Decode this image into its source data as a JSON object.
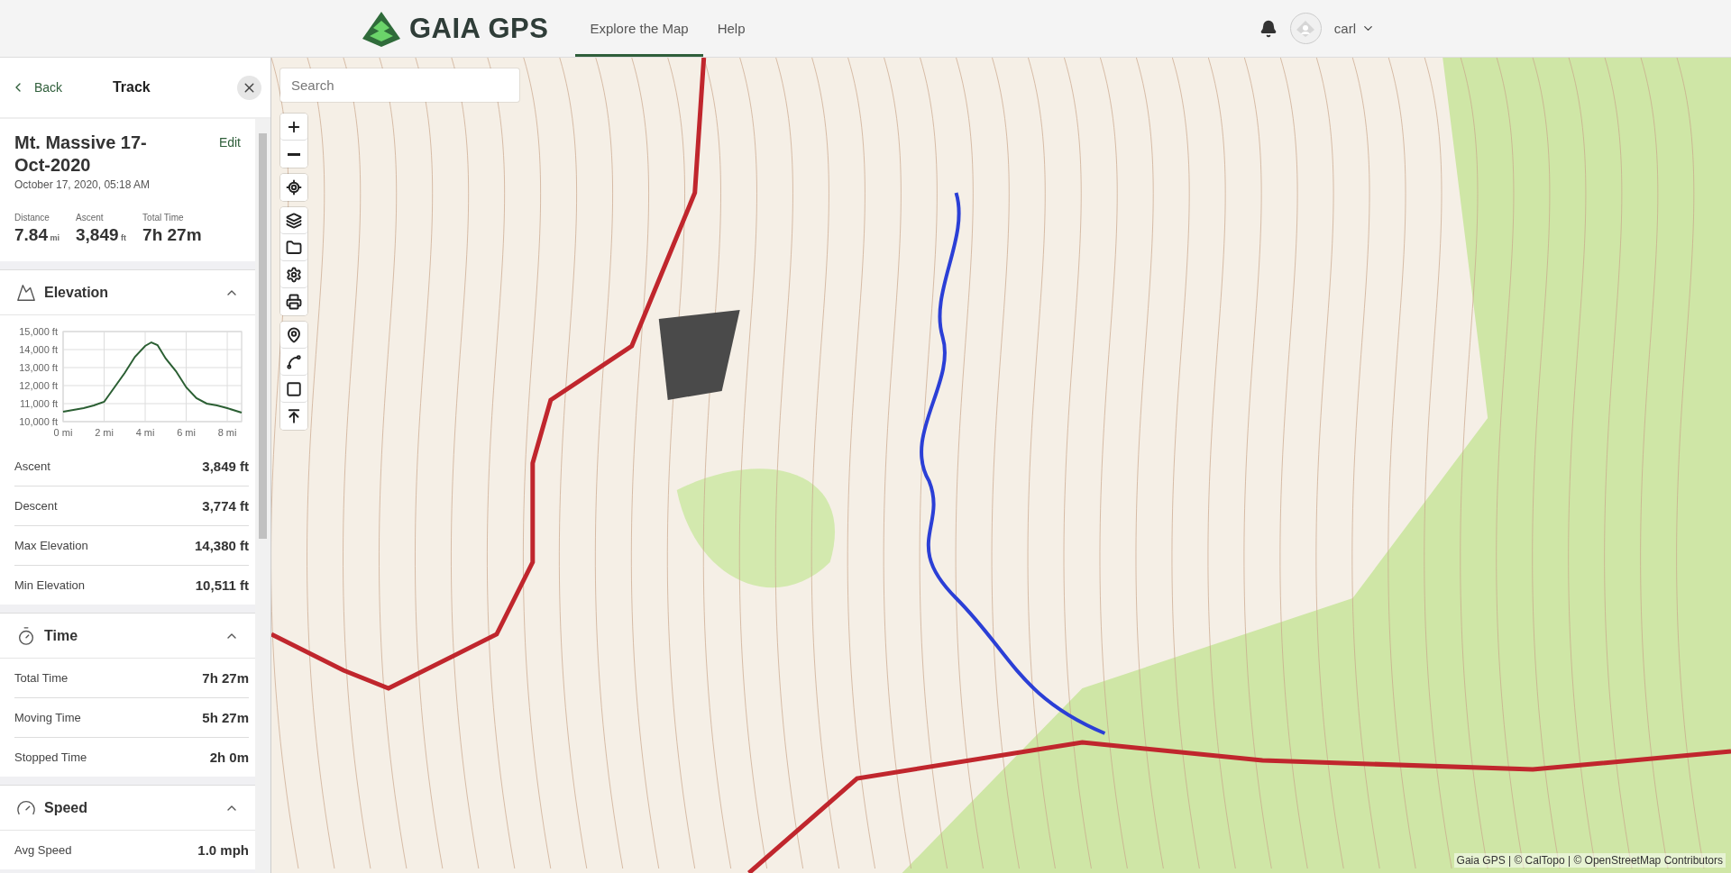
{
  "header": {
    "logo_text": "GAIA GPS",
    "nav": [
      {
        "label": "Explore the Map",
        "selected": true
      },
      {
        "label": "Help",
        "selected": false
      }
    ],
    "user": "carl"
  },
  "sidebar": {
    "back": "Back",
    "title": "Track",
    "track": {
      "name": "Mt. Massive 17-Oct-2020",
      "edit": "Edit",
      "date": "October 17, 2020, 05:18 AM",
      "stats": [
        {
          "label": "Distance",
          "value": "7.84",
          "unit": "mi"
        },
        {
          "label": "Ascent",
          "value": "3,849",
          "unit": "ft"
        },
        {
          "label": "Total Time",
          "value": "7h 27m"
        }
      ]
    },
    "sections": [
      {
        "kind": "elevation",
        "title": "Elevation",
        "expanded": true,
        "chart_data": {
          "type": "line",
          "x": [
            0,
            0.5,
            1,
            1.5,
            2,
            2.5,
            3,
            3.5,
            4,
            4.3,
            4.6,
            5,
            5.5,
            6,
            6.5,
            7,
            7.5,
            8,
            8.7
          ],
          "grid": true,
          "series": [
            {
              "color": "#2b5f33",
              "values": [
                10550,
                10650,
                10750,
                10900,
                11100,
                11900,
                12700,
                13600,
                14200,
                14400,
                14250,
                13500,
                12800,
                11900,
                11300,
                11000,
                10900,
                10750,
                10500
              ]
            }
          ],
          "xlim": [
            0,
            8.7
          ],
          "ylim": [
            10000,
            15000
          ],
          "xticks": [
            {
              "value": 0,
              "label": "0 mi"
            },
            {
              "value": 2,
              "label": "2 mi"
            },
            {
              "value": 4,
              "label": "4 mi"
            },
            {
              "value": 6,
              "label": "6 mi"
            },
            {
              "value": 8,
              "label": "8 mi"
            }
          ],
          "yticks": [
            {
              "value": 10000,
              "label": "10,000 ft"
            },
            {
              "value": 11000,
              "label": "11,000 ft"
            },
            {
              "value": 12000,
              "label": "12,000 ft"
            },
            {
              "value": 13000,
              "label": "13,000 ft"
            },
            {
              "value": 14000,
              "label": "14,000 ft"
            },
            {
              "value": 15000,
              "label": "15,000 ft"
            }
          ]
        },
        "rows": [
          {
            "label": "Ascent",
            "value": "3,849 ft"
          },
          {
            "label": "Descent",
            "value": "3,774 ft"
          },
          {
            "label": "Max Elevation",
            "value": "14,380 ft"
          },
          {
            "label": "Min Elevation",
            "value": "10,511 ft"
          }
        ]
      },
      {
        "kind": "time",
        "title": "Time",
        "expanded": true,
        "rows": [
          {
            "label": "Total Time",
            "value": "7h 27m"
          },
          {
            "label": "Moving Time",
            "value": "5h 27m"
          },
          {
            "label": "Stopped Time",
            "value": "2h 0m"
          }
        ]
      },
      {
        "kind": "speed",
        "title": "Speed",
        "expanded": true,
        "rows": [
          {
            "label": "Avg Speed",
            "value": "1.0 mph"
          }
        ]
      }
    ]
  },
  "map": {
    "search": {
      "placeholder": "Search"
    },
    "attribution": "Gaia GPS | © CalTopo | © OpenStreetMap Contributors"
  }
}
